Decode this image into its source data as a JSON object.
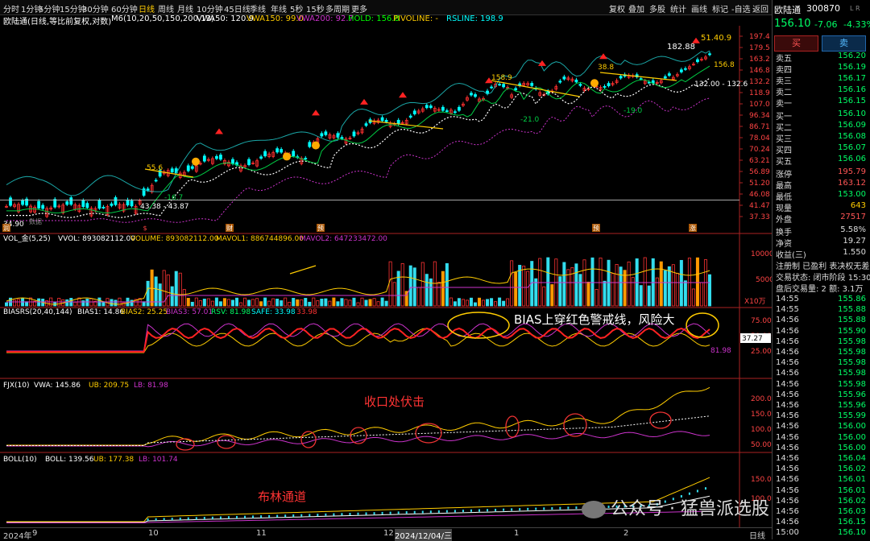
{
  "toolbar": {
    "periods": [
      "分时",
      "1分钟",
      "5分钟",
      "15分钟",
      "30分钟",
      "60分钟",
      "日线",
      "周线",
      "月线",
      "10分钟",
      "45日线",
      "季线",
      "年线",
      "5秒",
      "15秒",
      "多周期",
      "更多"
    ],
    "active_period": "日线",
    "tools": [
      "复权",
      "叠加",
      "多股",
      "统计",
      "画线",
      "标记",
      "-自选",
      "返回"
    ],
    "win_icons": [
      "⊙",
      "☰"
    ]
  },
  "info": {
    "title": "欧陆通(日线,等比前复权,对数)",
    "ma": "M6(10,20,50,150,200,13)",
    "vwa50": "VWA50: 120.9",
    "vwa150": "VWA150: 99.0",
    "vwa200": "VWA200: 92.7",
    "hold": "HOLD: 156.8",
    "pivot": "PIVOLINE: -",
    "rsline": "RSLINE: 198.9"
  },
  "main_axis": [
    "197.4",
    "179.5",
    "163.2",
    "146.8",
    "132.2",
    "118.9",
    "107.0",
    "96.34",
    "86.71",
    "78.04",
    "70.24",
    "63.21",
    "56.89",
    "51.20",
    "46.08",
    "41.47",
    "37.33"
  ],
  "main_labels": {
    "hi1": "182.88",
    "hi2": "51.40.9",
    "p1": "156.8",
    "r1": "132.00 - 132.6",
    "a1": "38.8",
    "a2": "158.9",
    "a3": "-21.0",
    "a4": "-19.0",
    "a5": "55.6",
    "a6": "-16.7",
    "a7": "43.38 - 43.87",
    "a8": "34.90",
    "a9": "数据"
  },
  "event_marks": [
    "润",
    "$",
    "财",
    "预",
    "预",
    "涨"
  ],
  "vol": {
    "label": "VOL_金(5,25)",
    "vvol": "VVOL: 893082112.00",
    "volume": "VOLUME: 893082112.00",
    "mavol1": "MAVOL1: 886744896.00",
    "mavol2": "MAVOL2: 647233472.00",
    "axis": [
      "10000",
      "5000"
    ],
    "unit": "X10万"
  },
  "bias": {
    "label": "BIASRS(20,40,144)",
    "b1": "BIAS1: 14.86",
    "b2": "BIAS2: 25.25",
    "b3": "BIAS3: 57.01",
    "rsv": "RSV: 81.98",
    "safe": "SAFE: 33.98",
    "last": "33.98",
    "axis": [
      "75.00",
      "50.00",
      "25.00"
    ],
    "cur": "37.27",
    "tag": "81.98",
    "note": "BIAS上穿红色警戒线，风险大"
  },
  "fjx": {
    "label": "FJX(10)",
    "vwa": "VWA: 145.86",
    "ub": "UB: 209.75",
    "lb": "LB: 81.98",
    "axis": [
      "200.0",
      "150.0",
      "100.0",
      "50.00"
    ],
    "note": "收口处伏击"
  },
  "boll": {
    "label": "BOLL(10)",
    "boll": "BOLL: 139.56",
    "ub": "UB: 177.38",
    "lb": "LB: 101.74",
    "axis": [
      "150.0",
      "100.0"
    ],
    "note": "布林通道"
  },
  "bottom_axis": [
    "2024年",
    "9",
    "10",
    "11",
    "12",
    "2024/12/04/三",
    "1",
    "2"
  ],
  "bottom_right": "日线",
  "watermark": "公众号 · 猛兽派选股",
  "quote": {
    "name": "欧陆通",
    "code": "300870",
    "flags": "L R",
    "price": "156.10",
    "change": "-7.06",
    "pct": "-4.33%",
    "buy": "买",
    "sell": "卖",
    "sells": [
      [
        "卖五",
        "156.20"
      ],
      [
        "卖四",
        "156.19"
      ],
      [
        "卖三",
        "156.17"
      ],
      [
        "卖二",
        "156.16"
      ],
      [
        "卖一",
        "156.15"
      ]
    ],
    "buys": [
      [
        "买一",
        "156.10"
      ],
      [
        "买二",
        "156.09"
      ],
      [
        "买三",
        "156.08"
      ],
      [
        "买四",
        "156.07"
      ],
      [
        "买五",
        "156.06"
      ]
    ],
    "stats": [
      [
        "涨停",
        "195.79"
      ],
      [
        "最高",
        "163.12"
      ],
      [
        "最低",
        "153.00"
      ],
      [
        "现量",
        "643"
      ],
      [
        "外盘",
        "27517"
      ]
    ],
    "stats2": [
      [
        "换手",
        "5.58%"
      ],
      [
        "净资",
        "19.27"
      ],
      [
        "收益(三)",
        "1.550"
      ]
    ],
    "regs": "注册制 已盈利 表决权无差",
    "status": "交易状态: 闭市阶段 15:30",
    "after": "盘后交易量: 2 额: 3.1万",
    "ticks": [
      [
        "14:55",
        "155.86"
      ],
      [
        "14:55",
        "155.88"
      ],
      [
        "14:56",
        "155.88"
      ],
      [
        "14:56",
        "155.90"
      ],
      [
        "14:56",
        "155.98"
      ],
      [
        "14:56",
        "155.98"
      ],
      [
        "14:56",
        "155.98"
      ],
      [
        "14:56",
        "155.98"
      ],
      [
        "14:56",
        "155.98"
      ],
      [
        "14:56",
        "155.96"
      ],
      [
        "14:56",
        "155.96"
      ],
      [
        "14:56",
        "155.99"
      ],
      [
        "14:56",
        "156.00"
      ],
      [
        "14:56",
        "156.00"
      ],
      [
        "14:56",
        "156.00"
      ],
      [
        "14:56",
        "156.04"
      ],
      [
        "14:56",
        "156.02"
      ],
      [
        "14:56",
        "156.01"
      ],
      [
        "14:56",
        "156.01"
      ],
      [
        "14:56",
        "156.02"
      ],
      [
        "14:56",
        "156.03"
      ],
      [
        "14:56",
        "156.15"
      ],
      [
        "15:00",
        "156.10"
      ]
    ]
  },
  "colors": {
    "up": "#ff3030",
    "down": "#00ffff",
    "yellow": "#ffcc00",
    "magenta": "#cc33cc",
    "green": "#00cc44",
    "orange": "#ff9900",
    "white": "#ffffff"
  }
}
